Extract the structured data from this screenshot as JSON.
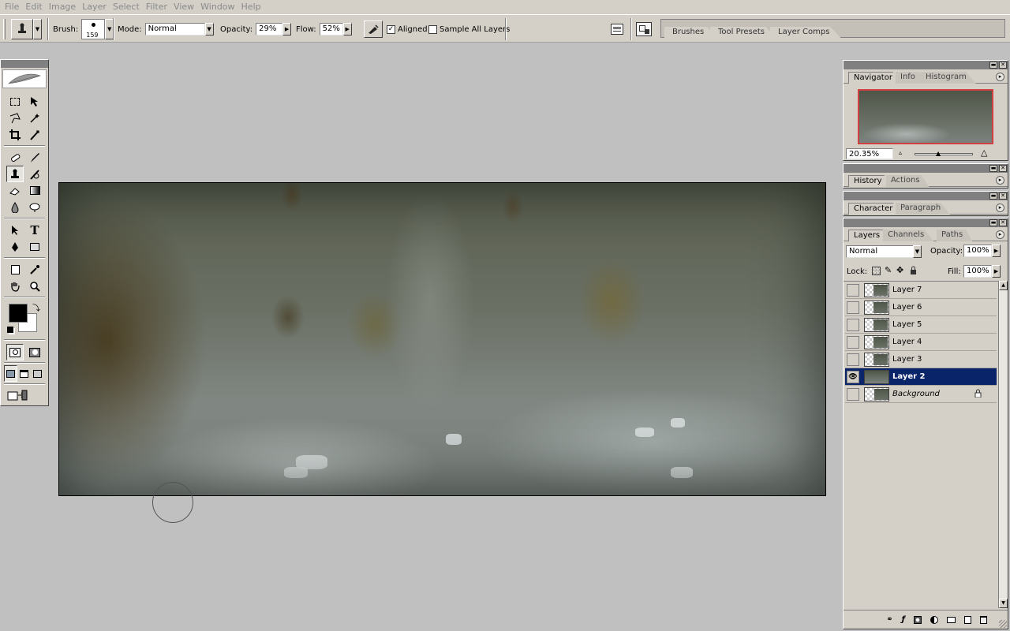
{
  "menu": [
    "File",
    "Edit",
    "Image",
    "Layer",
    "Select",
    "Filter",
    "View",
    "Window",
    "Help"
  ],
  "options": {
    "brush_label": "Brush:",
    "brush_size": "159",
    "mode_label": "Mode:",
    "mode_value": "Normal",
    "opacity_label": "Opacity:",
    "opacity_value": "29%",
    "flow_label": "Flow:",
    "flow_value": "52%",
    "aligned_label": "Aligned",
    "aligned_checked": "✓",
    "sample_all_label": "Sample All Layers"
  },
  "well_tabs": [
    "Brushes",
    "Tool Presets",
    "Layer Comps"
  ],
  "navigator": {
    "tabs": [
      "Navigator",
      "Info",
      "Histogram"
    ],
    "zoom": "20.35%"
  },
  "history": {
    "tabs": [
      "History",
      "Actions"
    ]
  },
  "character": {
    "tabs": [
      "Character",
      "Paragraph"
    ]
  },
  "layers": {
    "tabs": [
      "Layers",
      "Channels",
      "Paths"
    ],
    "blend_mode": "Normal",
    "opacity_label": "Opacity:",
    "opacity_value": "100%",
    "lock_label": "Lock:",
    "fill_label": "Fill:",
    "fill_value": "100%",
    "items": [
      {
        "name": "Layer 7"
      },
      {
        "name": "Layer 6"
      },
      {
        "name": "Layer 5"
      },
      {
        "name": "Layer 4"
      },
      {
        "name": "Layer 3"
      },
      {
        "name": "Layer 2",
        "selected": true,
        "visible": true
      },
      {
        "name": "Background",
        "locked": true
      }
    ]
  },
  "colors": {
    "foreground": "#000000",
    "background": "#ffffff",
    "selection": "#0a246a",
    "navigator_frame": "#d04040"
  }
}
